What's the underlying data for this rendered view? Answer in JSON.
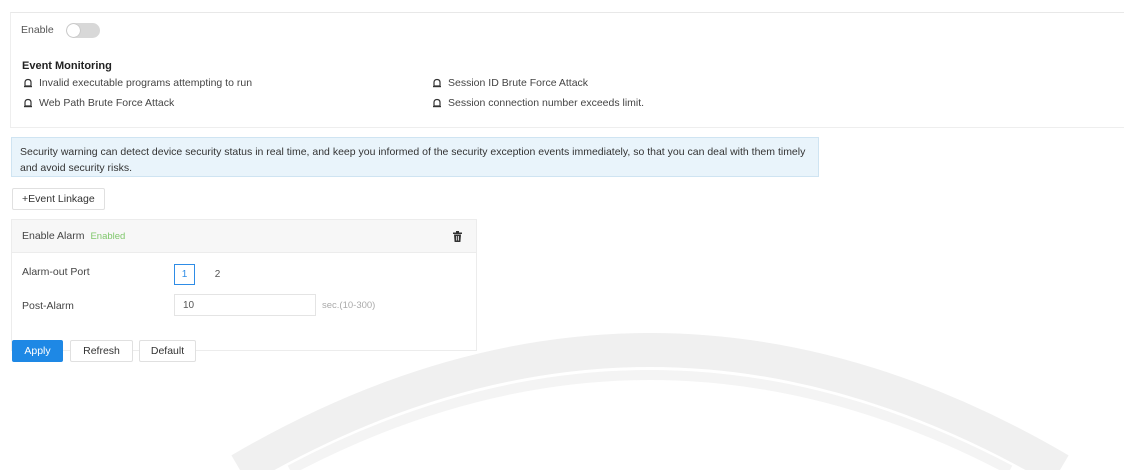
{
  "enable": {
    "label": "Enable",
    "state": "off"
  },
  "event_monitoring": {
    "title": "Event Monitoring",
    "items": [
      {
        "label": "Invalid executable programs attempting to run",
        "icon": "bell-icon"
      },
      {
        "label": "Session ID Brute Force Attack",
        "icon": "bell-icon"
      },
      {
        "label": "Web Path Brute Force Attack",
        "icon": "bell-icon"
      },
      {
        "label": "Session connection number exceeds limit.",
        "icon": "bell-icon"
      }
    ]
  },
  "info": {
    "text": "Security warning can detect device security status in real time, and keep you informed of the security exception events immediately, so that you can deal with them timely and avoid security risks."
  },
  "event_linkage_button": "+Event Linkage",
  "linkage": {
    "enable_alarm_label": "Enable Alarm",
    "enable_alarm_status": "Enabled",
    "alarm_out_port_label": "Alarm-out Port",
    "ports": [
      "1",
      "2"
    ],
    "selected_port": "1",
    "post_alarm_label": "Post-Alarm",
    "post_alarm_value": "10",
    "post_alarm_unit": "sec.(10-300)"
  },
  "buttons": {
    "apply": "Apply",
    "refresh": "Refresh",
    "default": "Default"
  },
  "colors": {
    "accent": "#1e88e5",
    "info_bg": "#e9f4fb",
    "enabled_text": "#7fc76b"
  }
}
